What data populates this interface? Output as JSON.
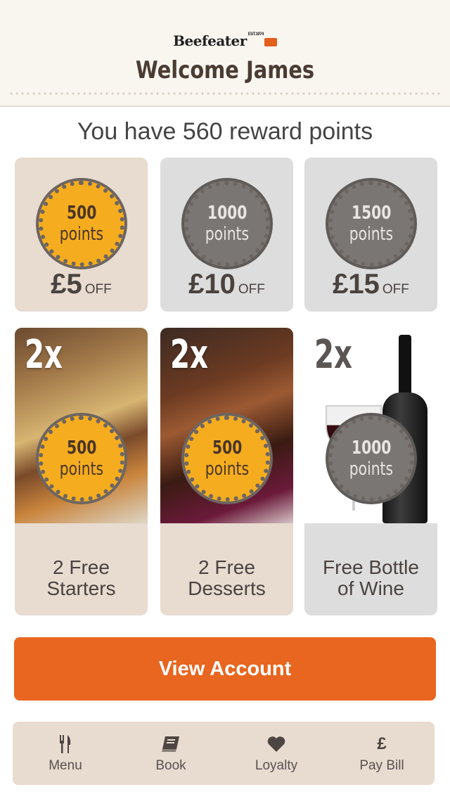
{
  "header": {
    "logo_text": "Beefeater",
    "logo_est": "EST.1974",
    "welcome": "Welcome James"
  },
  "rewards": {
    "points_line": "You have 560 reward points"
  },
  "voucher_cards": [
    {
      "points": "500",
      "points_label": "points",
      "amount": "£5",
      "off": "OFF",
      "style": "gold"
    },
    {
      "points": "1000",
      "points_label": "points",
      "amount": "£10",
      "off": "OFF",
      "style": "dark"
    },
    {
      "points": "1500",
      "points_label": "points",
      "amount": "£15",
      "off": "OFF",
      "style": "dark"
    }
  ],
  "food_cards": [
    {
      "multiplier": "2x",
      "points": "500",
      "points_label": "points",
      "label_line1": "2 Free",
      "label_line2": "Starters"
    },
    {
      "multiplier": "2x",
      "points": "500",
      "points_label": "points",
      "label_line1": "2 Free",
      "label_line2": "Desserts"
    },
    {
      "multiplier": "2x",
      "points": "1000",
      "points_label": "points",
      "label_line1": "Free Bottle",
      "label_line2": "of Wine"
    }
  ],
  "actions": {
    "view_account": "View Account"
  },
  "tabbar": {
    "items": [
      {
        "label": "Menu",
        "icon": "cutlery-icon"
      },
      {
        "label": "Book",
        "icon": "book-icon"
      },
      {
        "label": "Loyalty",
        "icon": "heart-icon"
      },
      {
        "label": "Pay Bill",
        "icon": "pound-icon",
        "glyph": "£"
      }
    ]
  },
  "colors": {
    "accent_orange": "#e8661f",
    "badge_gold": "#f5ad1f",
    "badge_dark": "#7a7674",
    "card_tan": "#e8dbd0",
    "card_grey": "#dddddd"
  }
}
